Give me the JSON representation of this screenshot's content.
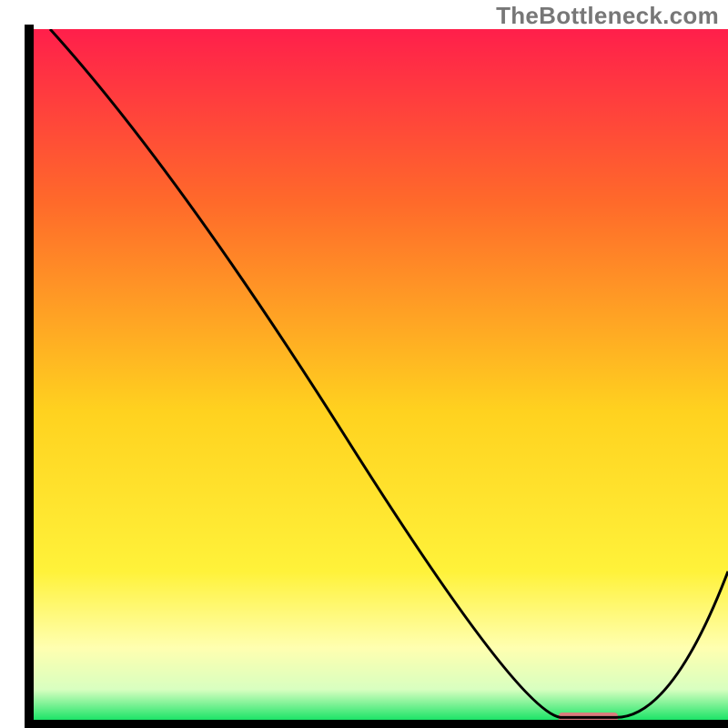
{
  "watermark": "TheBottleneck.com",
  "chart_data": {
    "type": "line",
    "title": "",
    "xlabel": "",
    "ylabel": "",
    "xlim": [
      0,
      100
    ],
    "ylim": [
      0,
      100
    ],
    "grid": false,
    "legend": false,
    "x": [
      3,
      21,
      70,
      76,
      84,
      100
    ],
    "y": [
      100,
      80,
      2,
      1,
      1,
      22
    ],
    "flat_segment": {
      "x_start": 76,
      "x_end": 84,
      "y": 1
    },
    "gradient_stops": [
      {
        "offset": 0,
        "color": "#ff1f4b"
      },
      {
        "offset": 25,
        "color": "#ff6a2a"
      },
      {
        "offset": 55,
        "color": "#ffd21f"
      },
      {
        "offset": 78,
        "color": "#fff23a"
      },
      {
        "offset": 89,
        "color": "#ffffb0"
      },
      {
        "offset": 95,
        "color": "#d8ffc0"
      },
      {
        "offset": 100,
        "color": "#00e05a"
      }
    ],
    "marker": {
      "x_center": 80,
      "width_pct": 8.5,
      "height_pct": 1.4,
      "color": "#d97d7d"
    },
    "colors": {
      "line": "#000000",
      "frame": "#000000",
      "background": "#ffffff"
    }
  }
}
